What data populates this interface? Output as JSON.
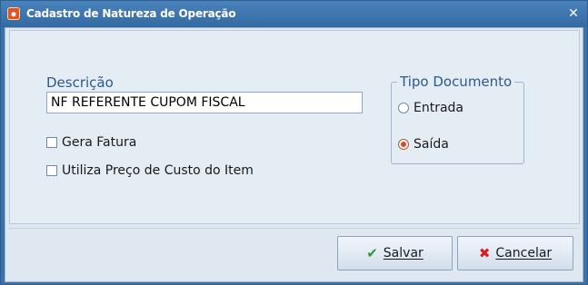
{
  "window": {
    "title": "Cadastro de Natureza de Operação",
    "close_glyph": "✕"
  },
  "form": {
    "description_label": "Descrição",
    "description_value": "NF REFERENTE CUPOM FISCAL",
    "gera_fatura_label": "Gera Fatura",
    "gera_fatura_checked": false,
    "utiliza_preco_label": "Utiliza Preço de Custo do Item",
    "utiliza_preco_checked": false
  },
  "tipo_documento": {
    "legend": "Tipo Documento",
    "options": [
      {
        "label": "Entrada",
        "selected": false
      },
      {
        "label": "Saída",
        "selected": true
      }
    ]
  },
  "buttons": {
    "save_label": "Salvar",
    "save_icon": "checkmark-icon",
    "cancel_label": "Cancelar",
    "cancel_icon": "x-icon"
  },
  "colors": {
    "titlebar": "#3d72a8",
    "accent_label": "#2c5a8c",
    "radio_selected": "#e0481f",
    "save_icon": "#2e9a2e",
    "cancel_icon": "#d42020"
  }
}
